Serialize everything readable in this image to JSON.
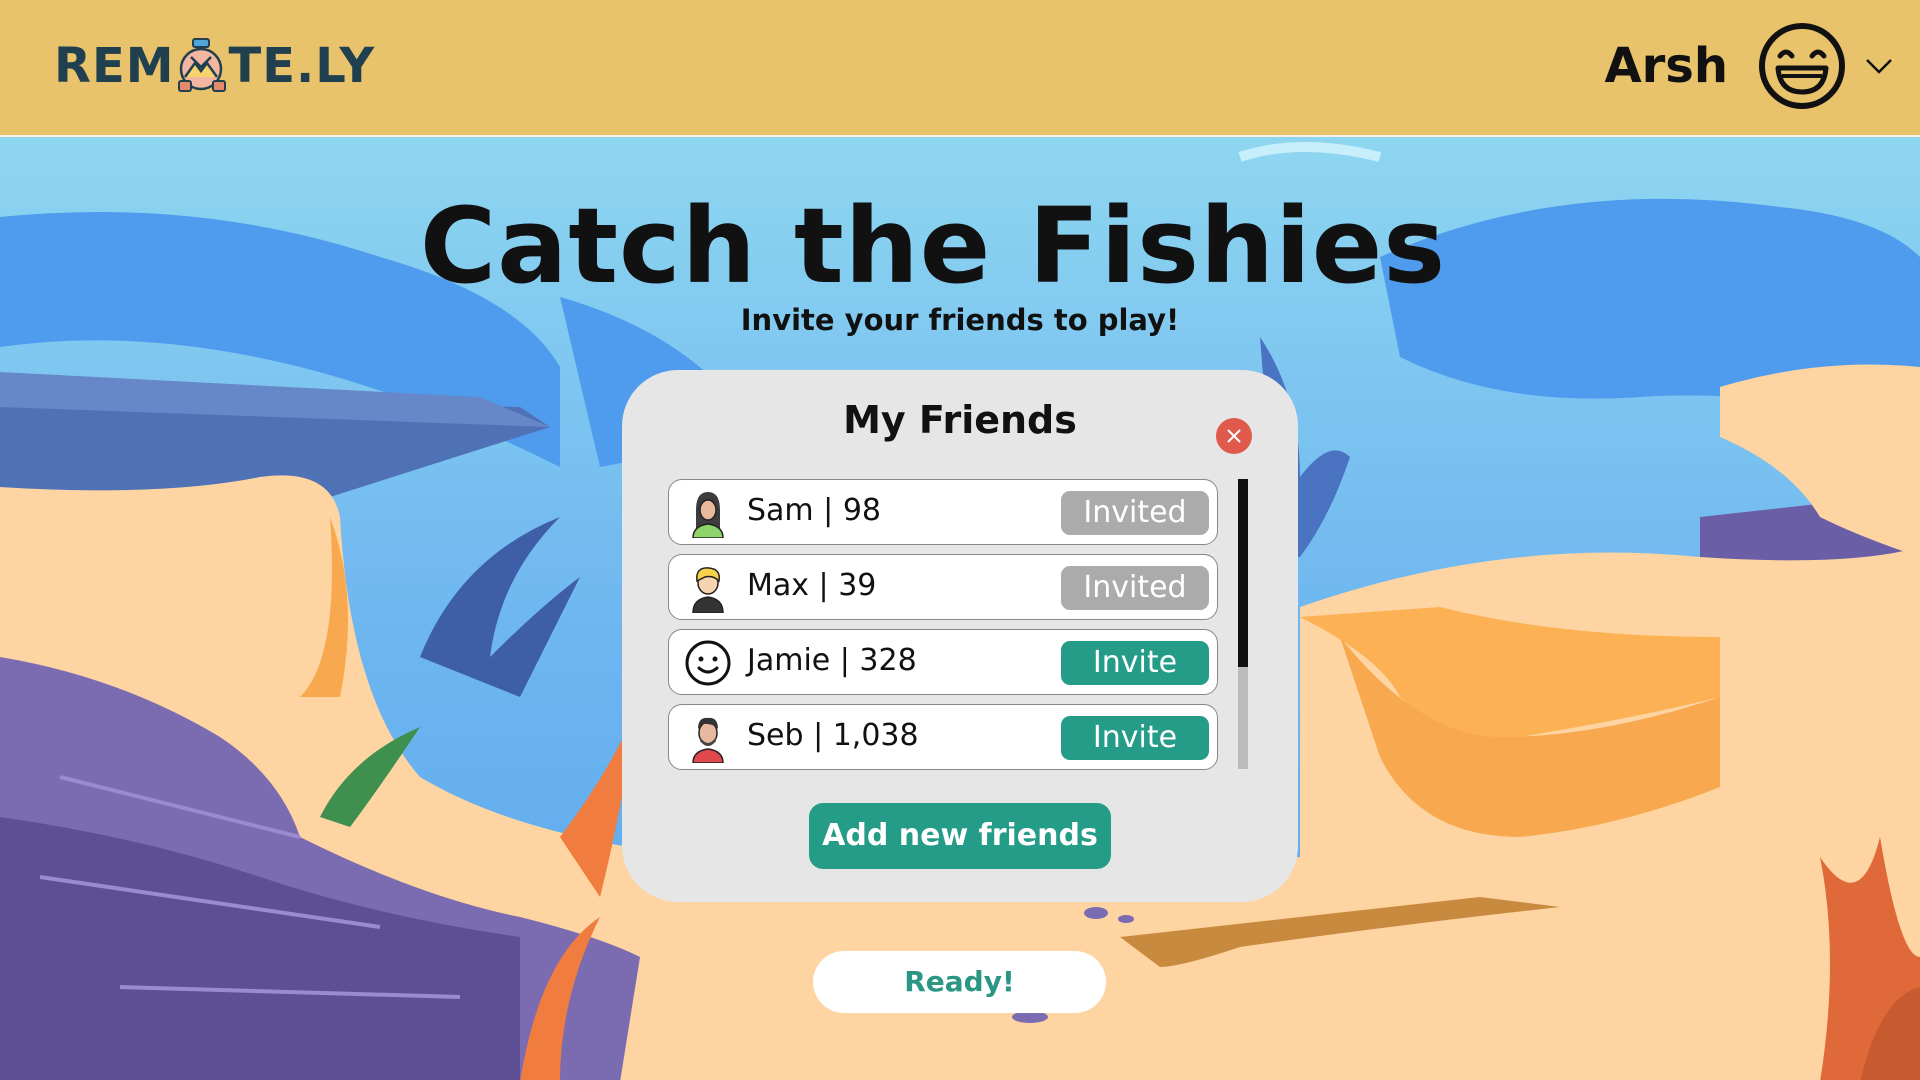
{
  "header": {
    "logo_left": "REM",
    "logo_right": "TE.LY",
    "user_name": "Arsh"
  },
  "main": {
    "title": "Catch the Fishies",
    "subtitle": "Invite your friends to play!"
  },
  "friends_panel": {
    "title": "My Friends",
    "friends": [
      {
        "label": "Sam | 98",
        "button": "Invited",
        "status": "invited",
        "avatar": "woman-avatar-icon"
      },
      {
        "label": "Max | 39",
        "button": "Invited",
        "status": "invited",
        "avatar": "blond-man-avatar-icon"
      },
      {
        "label": "Jamie | 328",
        "button": "Invite",
        "status": "invite",
        "avatar": "smiley-face-icon"
      },
      {
        "label": "Seb | 1,038",
        "button": "Invite",
        "status": "invite",
        "avatar": "bearded-man-avatar-icon"
      }
    ],
    "add_button": "Add new friends"
  },
  "ready_button": "Ready!",
  "colors": {
    "header_bg": "#e8c36b",
    "accent_teal": "#259c88",
    "invited_gray": "#ababab",
    "close_red": "#e05a4c",
    "logo_navy": "#21404f"
  }
}
